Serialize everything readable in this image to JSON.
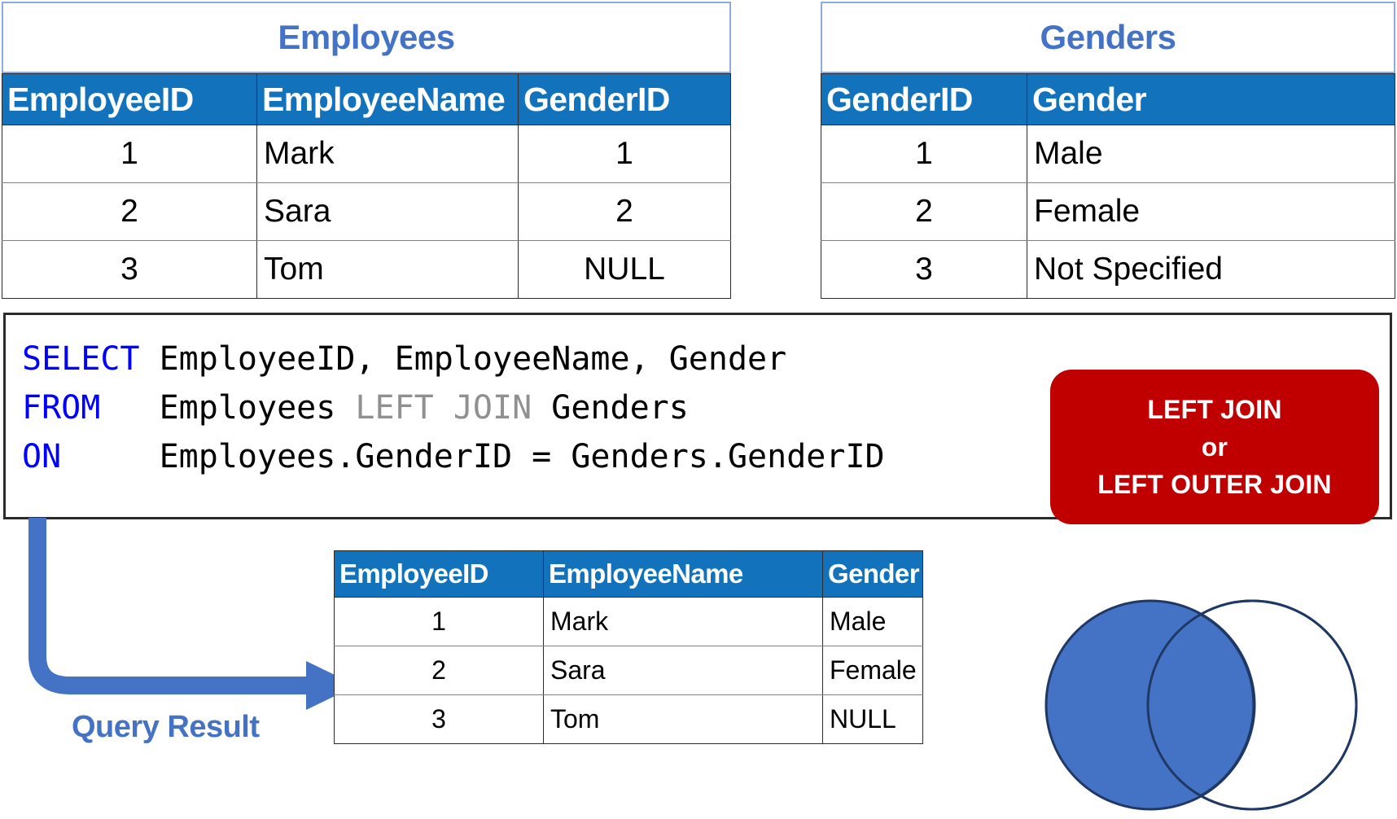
{
  "employees_table": {
    "title": "Employees",
    "columns": [
      "EmployeeID",
      "EmployeeName",
      "GenderID"
    ],
    "rows": [
      [
        "1",
        "Mark",
        "1"
      ],
      [
        "2",
        "Sara",
        "2"
      ],
      [
        "3",
        "Tom",
        "NULL"
      ]
    ]
  },
  "genders_table": {
    "title": "Genders",
    "columns": [
      "GenderID",
      "Gender"
    ],
    "rows": [
      [
        "1",
        "Male"
      ],
      [
        "2",
        "Female"
      ],
      [
        "3",
        "Not Specified"
      ]
    ]
  },
  "sql": {
    "line1": {
      "keyword": "SELECT",
      "body": "EmployeeID, EmployeeName, Gender"
    },
    "line2": {
      "keyword": "FROM",
      "table_left": "Employees",
      "join": "LEFT JOIN",
      "table_right": "Genders"
    },
    "line3": {
      "keyword": "ON",
      "condition": "Employees.GenderID = Genders.GenderID"
    },
    "full_text": "SELECT EmployeeID, EmployeeName, Gender\nFROM   Employees LEFT JOIN Genders\nON     Employees.GenderID = Genders.GenderID"
  },
  "join_badge": {
    "line1": "LEFT JOIN",
    "line2": "or",
    "line3": "LEFT OUTER JOIN",
    "color": "#c00000"
  },
  "arrow": {
    "label": "Query Result",
    "color": "#4472c4"
  },
  "result_table": {
    "columns": [
      "EmployeeID",
      "EmployeeName",
      "Gender"
    ],
    "rows": [
      [
        "1",
        "Mark",
        "Male"
      ],
      [
        "2",
        "Sara",
        "Female"
      ],
      [
        "3",
        "Tom",
        "NULL"
      ]
    ]
  },
  "venn": {
    "left_circle_fill": "#4472c4",
    "right_circle_fill": "#ffffff",
    "outline": "#1f3864"
  },
  "theme": {
    "header_blue": "#1272bc",
    "title_blue": "#4472c4",
    "keyword_blue": "#0000ff",
    "join_gray": "#909090"
  }
}
